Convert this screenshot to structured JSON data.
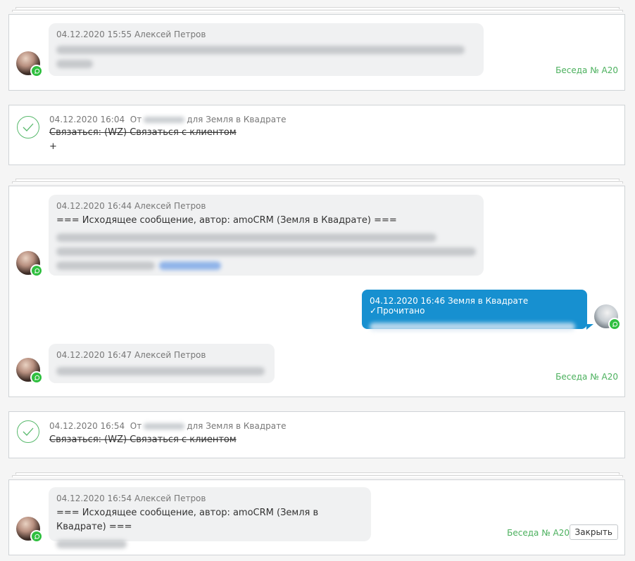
{
  "conversation_label": "Беседа № A20",
  "close_label": "Закрыть",
  "entries": [
    {
      "type": "chat",
      "messages": [
        {
          "direction": "in",
          "timestamp": "04.12.2020 15:55",
          "author": "Алексей Петров",
          "text": ""
        }
      ]
    },
    {
      "type": "task",
      "timestamp": "04.12.2020 16:04",
      "from_prefix": "От",
      "for_text": "для Земля в Квадрате",
      "title": "Связаться: (WZ) Связаться с клиентом",
      "extra": "+"
    },
    {
      "type": "chat",
      "messages": [
        {
          "direction": "in",
          "timestamp": "04.12.2020 16:44",
          "author": "Алексей Петров",
          "text": "=== Исходящее сообщение, автор: amoCRM (Земля в Квадрате) ==="
        },
        {
          "direction": "out",
          "timestamp": "04.12.2020 16:46",
          "author": "Земля в Квадрате",
          "status": "Прочитано",
          "text": ""
        },
        {
          "direction": "in",
          "timestamp": "04.12.2020 16:47",
          "author": "Алексей Петров",
          "text": ""
        }
      ]
    },
    {
      "type": "task",
      "timestamp": "04.12.2020 16:54",
      "from_prefix": "От",
      "for_text": "для Земля в Квадрате",
      "title": "Связаться: (WZ) Связаться с клиентом",
      "extra": ""
    },
    {
      "type": "chat",
      "messages": [
        {
          "direction": "in",
          "timestamp": "04.12.2020 16:54",
          "author": "Алексей Петров",
          "text": "=== Исходящее сообщение, автор: amoCRM (Земля в Квадрате) ==="
        }
      ]
    }
  ]
}
